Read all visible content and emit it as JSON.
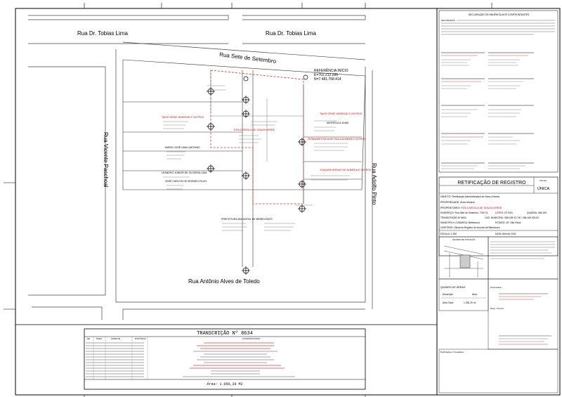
{
  "streets": {
    "tobias_left": "Rua Dr. Tobias Lima",
    "tobias_right": "Rua Dr. Tobias Lima",
    "sete": "Rua Sete de Setembro",
    "vicente": "Rua Vicente Paschoal",
    "adolfo": "Rua Adolfo Pinto",
    "antonio": "Rua Antônio Alves de Toledo"
  },
  "reference": {
    "title": "REFERÊNCIA INÍCIO",
    "e": "E=762.212.035",
    "n": "N=7.481.768.414"
  },
  "parcels": {
    "main_red": "RITA CASSOLA DE SOUZA VERDE",
    "red_left": "TAKIO ORISE MORISUE E OUTROS",
    "red_right": "TAKIO ORISE MORISUE E OUTROS",
    "red_right2": "FERNANDES SILVA DE PAULA ALMEIDA E OUTROS",
    "red_right3": "JOAQUIM MORAIS DE ALMEIDA E OUTROS",
    "left_a": "MARIO JOSÉ LIMA CAETANO",
    "left_b": "LEANDRO JUNIOR DE OLIVEIRA LIMA",
    "left_c": "JOSÉ CARLOS DE MORAES FILHO",
    "right_a": "MATRÍCULA 10466",
    "bottom": "PREFEITURA MUNICIPAL DE BEBEDOURO"
  },
  "declaration": {
    "title": "DECLARAÇÃO DE ANUÊNCIA DOS CONFRONTANTES",
    "lead": "DECLARAMOS"
  },
  "titleblock": {
    "title": "RETIFICAÇÃO DE REGISTRO",
    "sheet_label": "FOLHA",
    "sheet_value": "ÚNICA",
    "objeto_label": "OBJETO:",
    "objeto_value": "Retificação Administrativa de Área Urbana",
    "propriedade_label": "PROPRIEDADE:",
    "propriedade_value": "Área Urbana",
    "proprietario_label": "PROPRIETÁRIO:",
    "proprietario_value": "RITA CASSOLA DE SOUZA VERDE",
    "endereco": "ENDEREÇO: Rua Sete de Setembro, 703/711",
    "lotes": "LOTES: 07/7003",
    "quadra": "QUADRA: 086.169",
    "transcricao": "TRANSCRIÇÃO Nº 8634",
    "cad": "CAD. MUNICIPAL: 086.169.317.00 / 086.169.323.00",
    "municipio": "MUNICÍPIO e COMARCA: Bebedouro",
    "estado": "ESTADO: UF: São Paulo",
    "cartorio_label": "CARTÓRIO:",
    "cartorio_value": "Oficial de Registro de Imóveis de Bebedouro",
    "escala": "ESCALA: 1:250",
    "data": "DATA: Abril de 2024",
    "localizacao": "QUADRO DE SITUAÇÃO",
    "areas_title": "QUADRO DE ÁREAS:",
    "descricao_label": "Descrição",
    "area_label": "Área",
    "area_total_label": "Área Total:",
    "area_total_value": "1.050,20 m²",
    "proprietaria": "Proprietária:",
    "resp_tecnico": "Resp. Técnico:",
    "anotacoes": "Notificações / Anotações:"
  },
  "transcription": {
    "title": "TRANSCRIÇÃO Nº 8634",
    "headers": [
      "DE",
      "PARA",
      "AZIMUTE",
      "DISTÂNCIA",
      "CONFRONTANTE"
    ],
    "area": "Área: 1.050,20 M2"
  }
}
